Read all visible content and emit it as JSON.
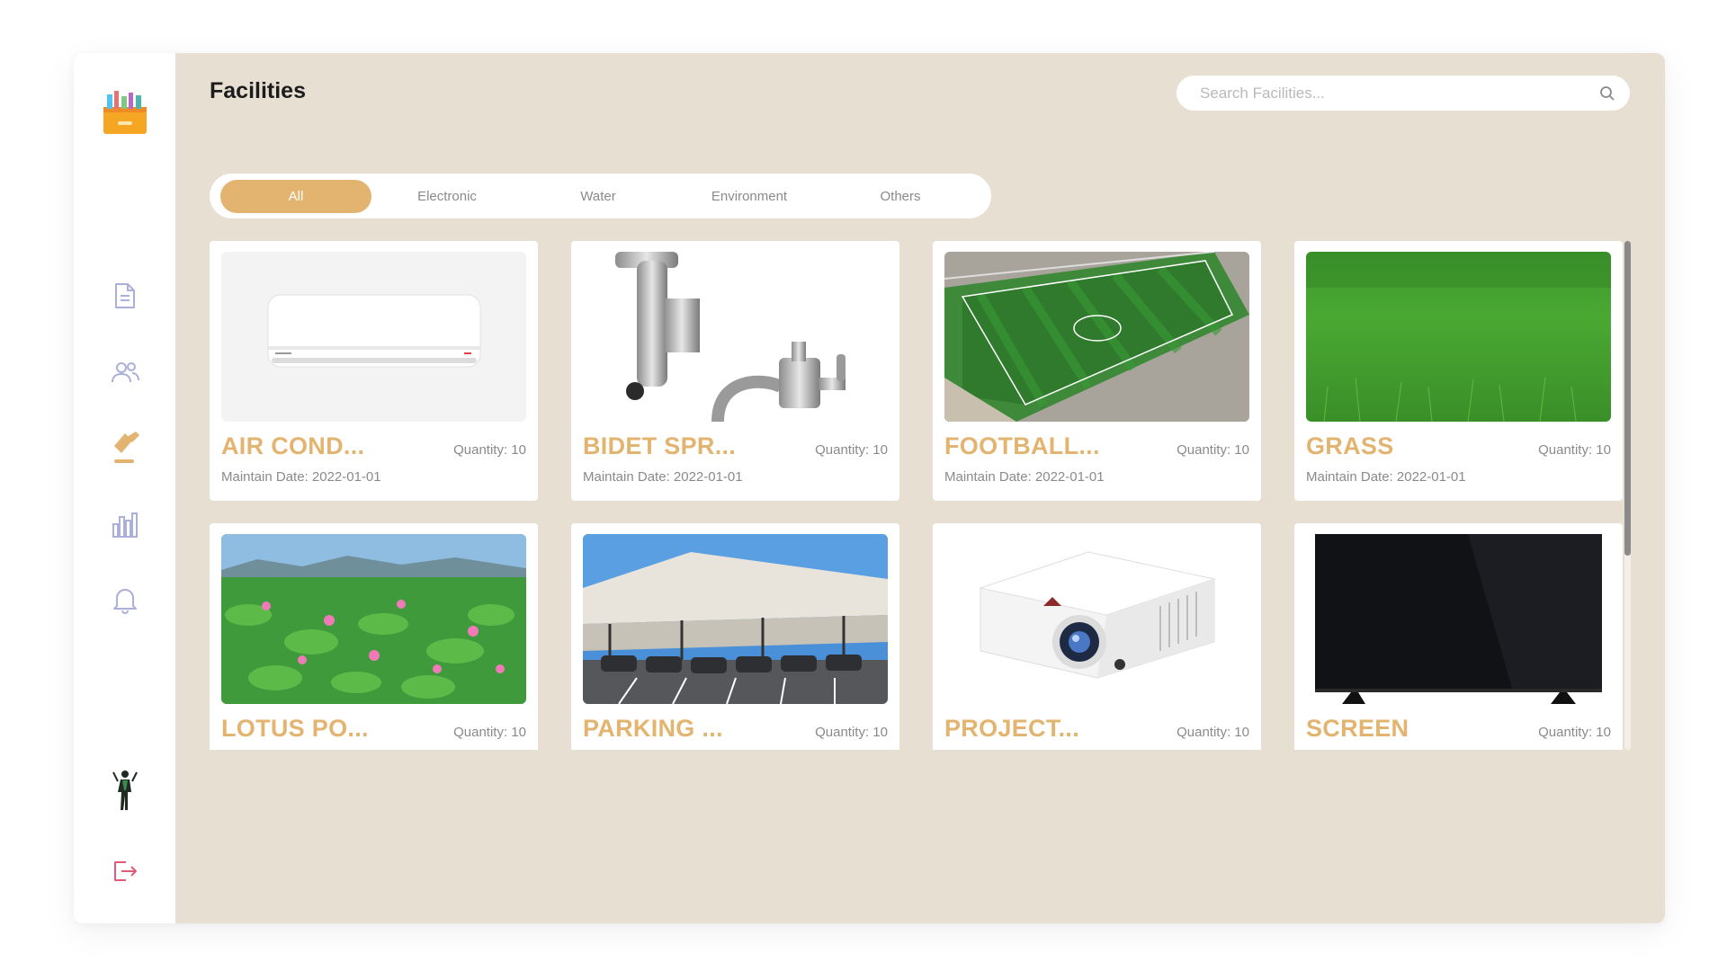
{
  "page": {
    "title": "Facilities"
  },
  "search": {
    "placeholder": "Search Facilities..."
  },
  "sidebar": {
    "items": [
      {
        "icon": "document-icon"
      },
      {
        "icon": "users-icon"
      },
      {
        "icon": "hammer-icon",
        "active": true
      },
      {
        "icon": "bar-chart-icon"
      },
      {
        "icon": "bell-icon"
      }
    ],
    "bottom": [
      {
        "icon": "avatar"
      },
      {
        "icon": "logout-icon"
      }
    ]
  },
  "tabs": [
    {
      "label": "All",
      "active": true
    },
    {
      "label": "Electronic"
    },
    {
      "label": "Water"
    },
    {
      "label": "Environment"
    },
    {
      "label": "Others"
    }
  ],
  "facilities": [
    {
      "name": "AIR COND...",
      "quantity": "Quantity: 10",
      "maintain_date": "Maintain Date: 2022-01-01"
    },
    {
      "name": "BIDET SPR...",
      "quantity": "Quantity: 10",
      "maintain_date": "Maintain Date: 2022-01-01"
    },
    {
      "name": "FOOTBALL...",
      "quantity": "Quantity: 10",
      "maintain_date": "Maintain Date: 2022-01-01"
    },
    {
      "name": "GRASS",
      "quantity": "Quantity: 10",
      "maintain_date": "Maintain Date: 2022-01-01"
    },
    {
      "name": "LOTUS PO...",
      "quantity": "Quantity: 10",
      "maintain_date": ""
    },
    {
      "name": "PARKING ...",
      "quantity": "Quantity: 10",
      "maintain_date": ""
    },
    {
      "name": "PROJECT...",
      "quantity": "Quantity: 10",
      "maintain_date": ""
    },
    {
      "name": "SCREEN",
      "quantity": "Quantity: 10",
      "maintain_date": ""
    }
  ],
  "colors": {
    "accent": "#e3b470",
    "background": "#e7dfd2",
    "muted": "#8a8a8a",
    "logout": "#e05a7a"
  }
}
